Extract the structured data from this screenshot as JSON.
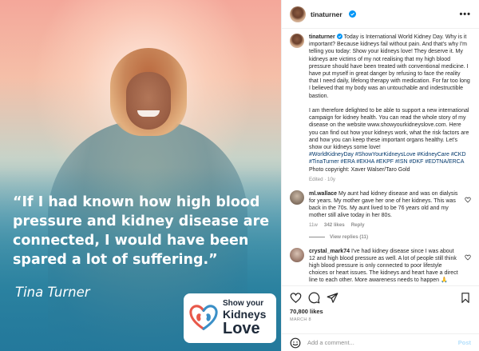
{
  "media": {
    "quote": "“If I had known how high blood pressure and kidney disease are connected, I would have been spared a lot of suffering.”",
    "author": "Tina Turner",
    "logo": {
      "line1": "Show your",
      "line2": "Kidneys",
      "line3": "Love"
    }
  },
  "header": {
    "username": "tinaturner",
    "more_glyph": "•••"
  },
  "caption": {
    "username": "tinaturner",
    "paragraph1": "Today is International World Kidney Day. Why is it important? Because kidneys fail without pain. And that's why I'm telling you today: Show your kidneys love! They deserve it. My kidneys are victims of my not realising that my high blood pressure should have been treated with conventional medicine. I have put myself in great danger by refusing to face the reality that I need daily, lifelong therapy with medication. For far too long I believed that my body was an untouchable and indestructible bastion.",
    "paragraph2": "I am therefore delighted to be able to support a new international campaign for kidney health. You can read the whole story of my disease on the website www.showyourkidneyslove.com. Here you can find out how your kidneys work, what the risk factors are and how you can keep these important organs healthy. Let's show our kidneys some love!",
    "hashtags": "#WorldKidneyDay #ShowYourKidneysLove #KidneyCare #CKD #TinaTurner #ERA #EKHA #EKPF #ISN #DKF #EDTNA/ERCA",
    "photo_credit": "Photo copyright: Xaver Walser/Taro Gold",
    "time": "Edited · 10y"
  },
  "comments": [
    {
      "username": "ml.wallace",
      "text": "My aunt had kidney disease and was on dialysis for years. My mother gave her one of her kidneys. This was back in the 70s. My aunt lived to be 76 years old and my mother still alive today in her 80s.",
      "time": "11w",
      "likes": "342 likes",
      "reply": "Reply",
      "view_replies": "View replies (11)"
    },
    {
      "username": "crystal_mark74",
      "text": "I've had kidney disease since I was about 12 and high blood pressure as well. A lot of people still think high blood pressure is only connected to poor lifestyle choices or heart issues. The kidneys and heart have a direct line to each other. More awareness needs to happen 🙏"
    }
  ],
  "actions": {
    "likes": "70,800 likes",
    "date": "MARCH 8"
  },
  "add_comment": {
    "placeholder": "Add a comment...",
    "post_label": "Post"
  },
  "colors": {
    "link": "#00376b",
    "verified": "#0095f6",
    "muted": "#8e8e8e",
    "post_disabled": "#b2dffc",
    "logo_red": "#e8584a",
    "logo_blue": "#3a8fc7"
  },
  "icons": [
    "verified-badge-icon",
    "more-options-icon",
    "heart-icon",
    "comment-icon",
    "share-icon",
    "bookmark-icon",
    "emoji-icon",
    "kidney-heart-logo-icon"
  ]
}
